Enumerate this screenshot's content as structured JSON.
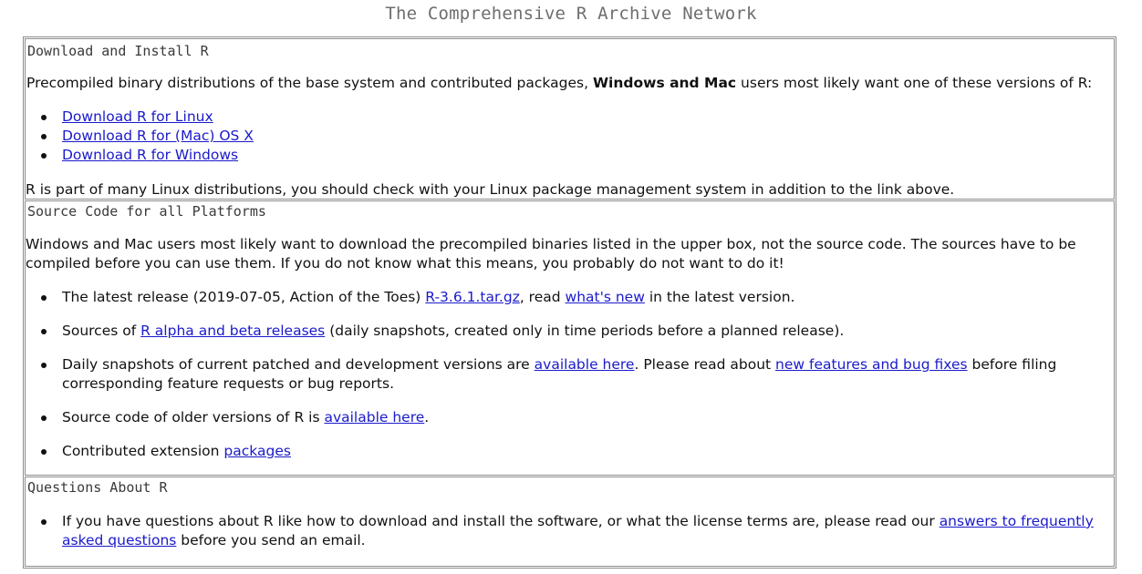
{
  "page_title": "The Comprehensive R Archive Network",
  "colors": {
    "link": "#1a1acc",
    "border": "#8c8c8c",
    "title_gray": "#6e6e6e"
  },
  "download_box": {
    "title": "Download and Install R",
    "intro_pre": "Precompiled binary distributions of the base system and contributed packages, ",
    "intro_bold": "Windows and Mac",
    "intro_post": " users most likely want one of these versions of R:",
    "links": [
      "Download R for Linux",
      "Download R for (Mac) OS X",
      "Download R for Windows"
    ],
    "footer": "R is part of many Linux distributions, you should check with your Linux package management system in addition to the link above."
  },
  "source_box": {
    "title": "Source Code for all Platforms",
    "intro": "Windows and Mac users most likely want to download the precompiled binaries listed in the upper box, not the source code. The sources have to be compiled before you can use them. If you do not know what this means, you probably do not want to do it!",
    "item1": {
      "pre": "The latest release (2019-07-05, Action of the Toes) ",
      "link1": "R-3.6.1.tar.gz",
      "mid": ", read ",
      "link2": "what's new",
      "post": " in the latest version."
    },
    "item2": {
      "pre": "Sources of ",
      "link": "R alpha and beta releases",
      "post": " (daily snapshots, created only in time periods before a planned release)."
    },
    "item3": {
      "pre": "Daily snapshots of current patched and development versions are ",
      "link1": "available here",
      "mid": ". Please read about ",
      "link2": "new features and bug fixes",
      "post": " before filing corresponding feature requests or bug reports."
    },
    "item4": {
      "pre": "Source code of older versions of R is ",
      "link": "available here",
      "post": "."
    },
    "item5": {
      "pre": "Contributed extension ",
      "link": "packages"
    }
  },
  "questions_box": {
    "title": "Questions About R",
    "item1": {
      "pre": "If you have questions about R like how to download and install the software, or what the license terms are, please read our ",
      "link": "answers to frequently asked questions",
      "post": " before you send an email."
    }
  }
}
